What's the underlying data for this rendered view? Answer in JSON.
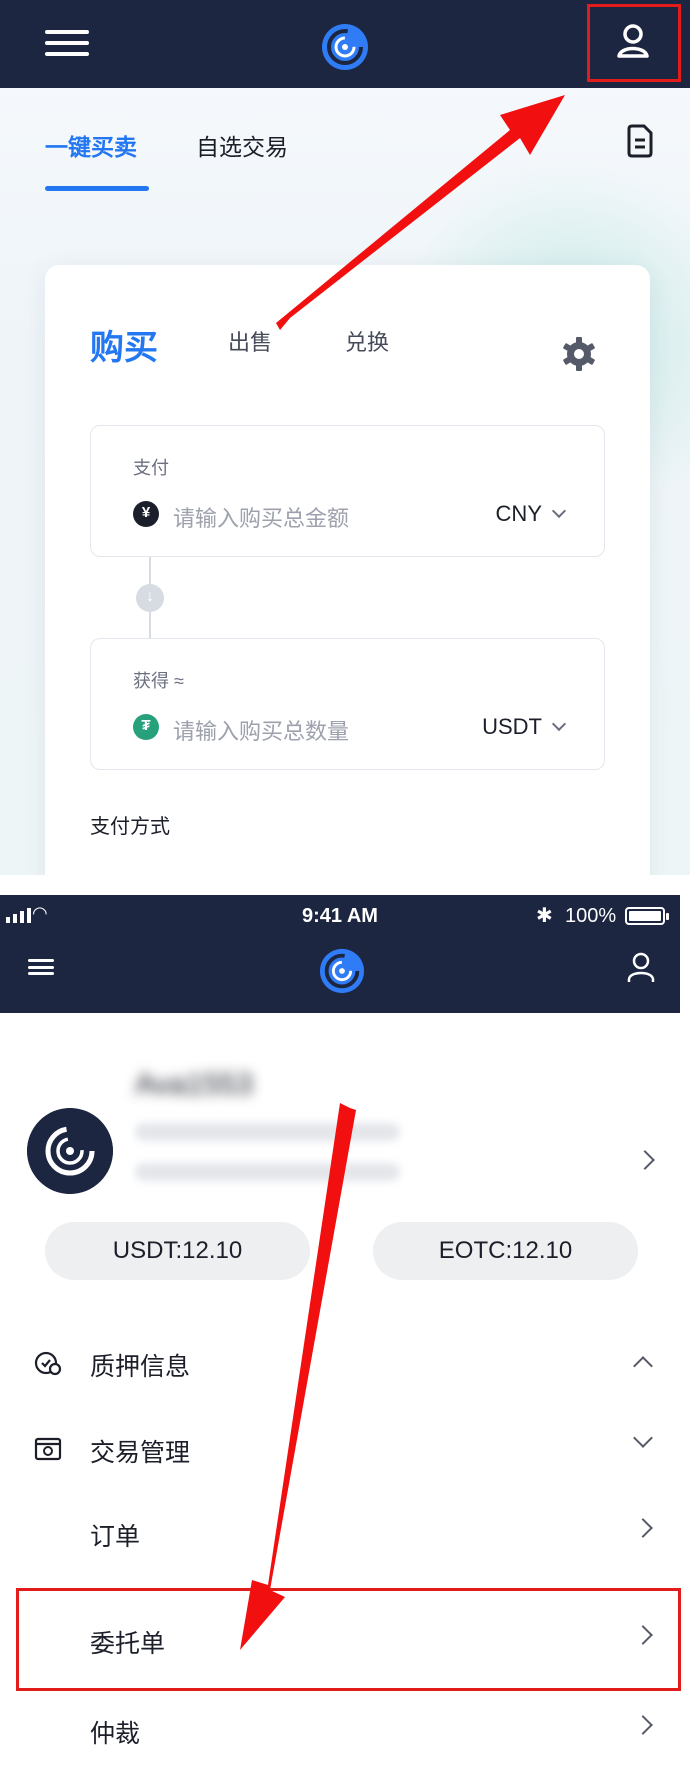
{
  "top_panel": {
    "tabs": [
      "一键买卖",
      "自选交易"
    ],
    "trade_tabs": {
      "buy": "购买",
      "sell": "出售",
      "swap": "兑换"
    },
    "pay": {
      "label": "支付",
      "placeholder": "请输入购买总金额",
      "currency": "CNY",
      "coin_glyph": "¥"
    },
    "receive": {
      "label": "获得 ≈",
      "placeholder": "请输入购买总数量",
      "currency": "USDT",
      "coin_glyph": "₮"
    },
    "payment_method_label": "支付方式"
  },
  "bottom_panel": {
    "status_bar": {
      "time": "9:41 AM",
      "battery": "100%"
    },
    "profile": {
      "name": "Ava1553"
    },
    "balances": [
      "USDT:12.10",
      "EOTC:12.10"
    ],
    "menu": [
      {
        "label": "质押信息",
        "icon": "pledge-icon",
        "chevron": "up"
      },
      {
        "label": "交易管理",
        "icon": "trade-management-icon",
        "chevron": "down"
      },
      {
        "label": "订单",
        "chevron": "right"
      },
      {
        "label": "委托单",
        "chevron": "right",
        "highlighted": true
      },
      {
        "label": "仲裁",
        "chevron": "right"
      }
    ]
  },
  "colors": {
    "nav_bg": "#1d2640",
    "accent": "#2377f2",
    "highlight_box": "#e21b1b",
    "arrow": "#f20f0f",
    "usdt_green": "#26a17b"
  }
}
